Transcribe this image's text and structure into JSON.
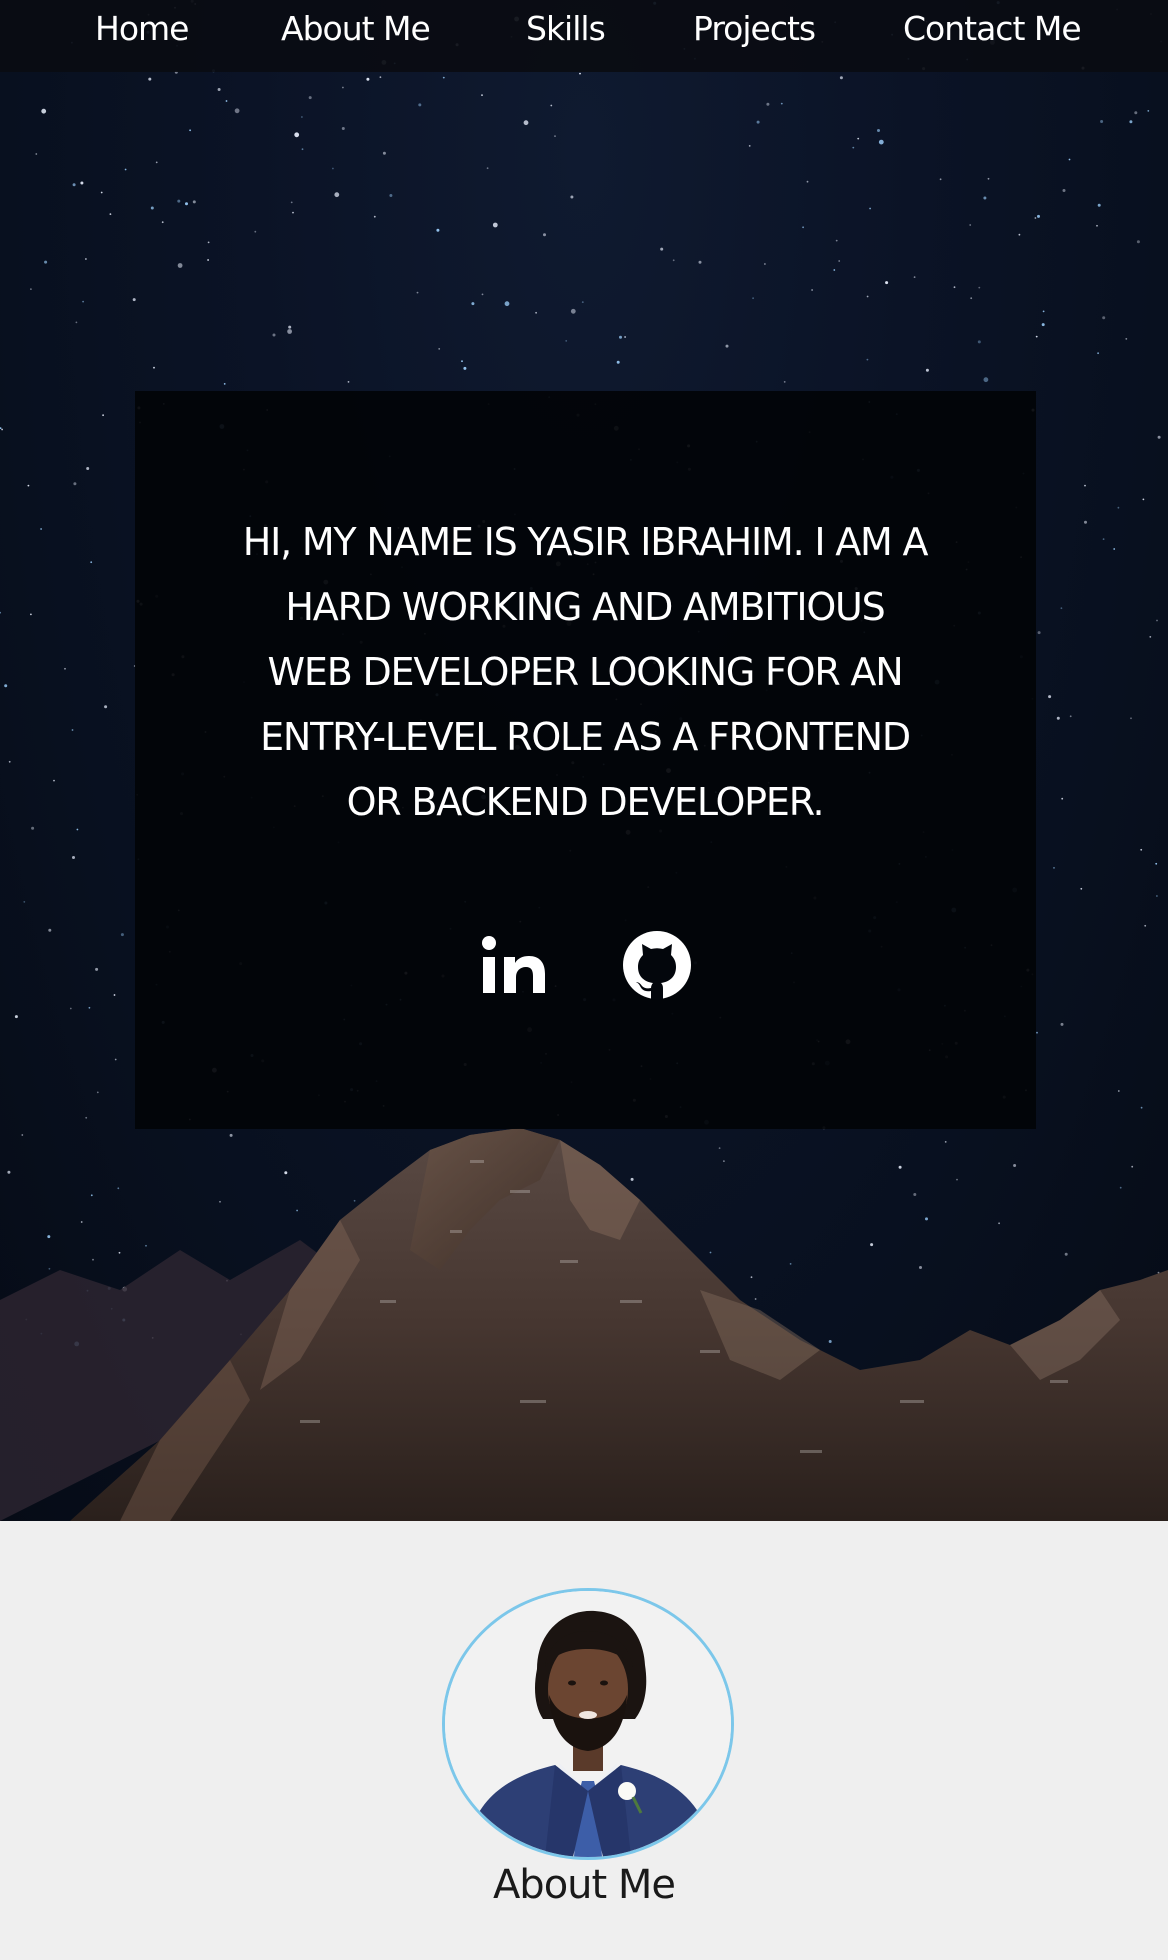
{
  "nav": {
    "items": [
      {
        "label": "Home"
      },
      {
        "label": "About Me"
      },
      {
        "label": "Skills"
      },
      {
        "label": "Projects"
      },
      {
        "label": "Contact Me"
      }
    ]
  },
  "hero": {
    "intro": "HI, MY NAME IS YASIR IBRAHIM. I AM A HARD WORKING AND AMBITIOUS WEB DEVELOPER LOOKING FOR AN ENTRY-LEVEL ROLE AS A FRONTEND OR BACKEND DEVELOPER.",
    "social": [
      {
        "icon": "linkedin-icon"
      },
      {
        "icon": "github-icon"
      }
    ]
  },
  "about": {
    "title": "About Me",
    "accent": "#7cc7ea"
  }
}
